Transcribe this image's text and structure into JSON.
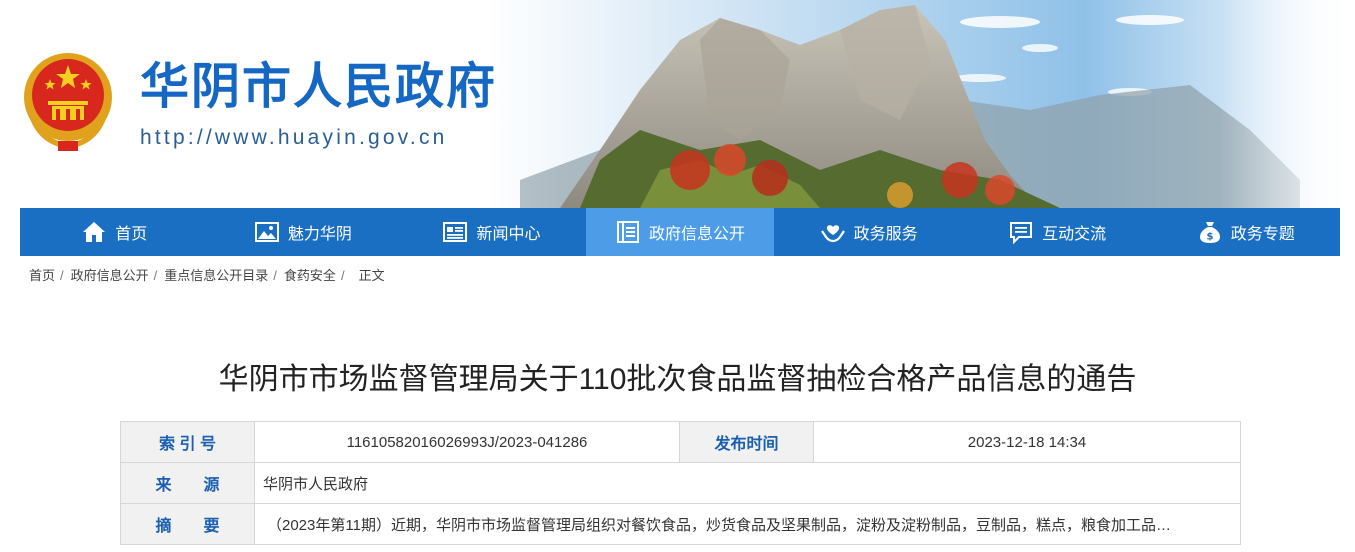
{
  "site": {
    "title": "华阴市人民政府",
    "url": "http://www.huayin.gov.cn"
  },
  "icons": {
    "emblem": "national-emblem",
    "nav": [
      "home-icon",
      "picture-icon",
      "newspaper-icon",
      "document-list-icon",
      "service-hands-icon",
      "chat-icon",
      "money-bag-icon"
    ]
  },
  "colors": {
    "nav_bg": "#1a6fc2",
    "nav_active": "#4d9ce8",
    "title_blue": "#1467c2",
    "label_blue": "#1a5fb0"
  },
  "nav": {
    "items": [
      {
        "label": "首页"
      },
      {
        "label": "魅力华阴"
      },
      {
        "label": "新闻中心"
      },
      {
        "label": "政府信息公开"
      },
      {
        "label": "政务服务"
      },
      {
        "label": "互动交流"
      },
      {
        "label": "政务专题"
      }
    ],
    "active": "政府信息公开"
  },
  "breadcrumb": {
    "items": [
      "首页",
      "政府信息公开",
      "重点信息公开目录",
      "食药安全"
    ],
    "current": "正文"
  },
  "article": {
    "title": "华阴市市场监督管理局关于110批次食品监督抽检合格产品信息的通告"
  },
  "info": {
    "index_label": "索 引 号",
    "index_value": "11610582016026993J/2023-041286",
    "date_label": "发布时间",
    "date_value": "2023-12-18 14:34",
    "source_label": "来　　源",
    "source_value": "华阴市人民政府",
    "summary_label": "摘　　要",
    "summary_value": "（2023年第11期）近期，华阴市市场监督管理局组织对餐饮食品，炒货食品及坚果制品，淀粉及淀粉制品，豆制品，糕点，粮食加工品…"
  }
}
